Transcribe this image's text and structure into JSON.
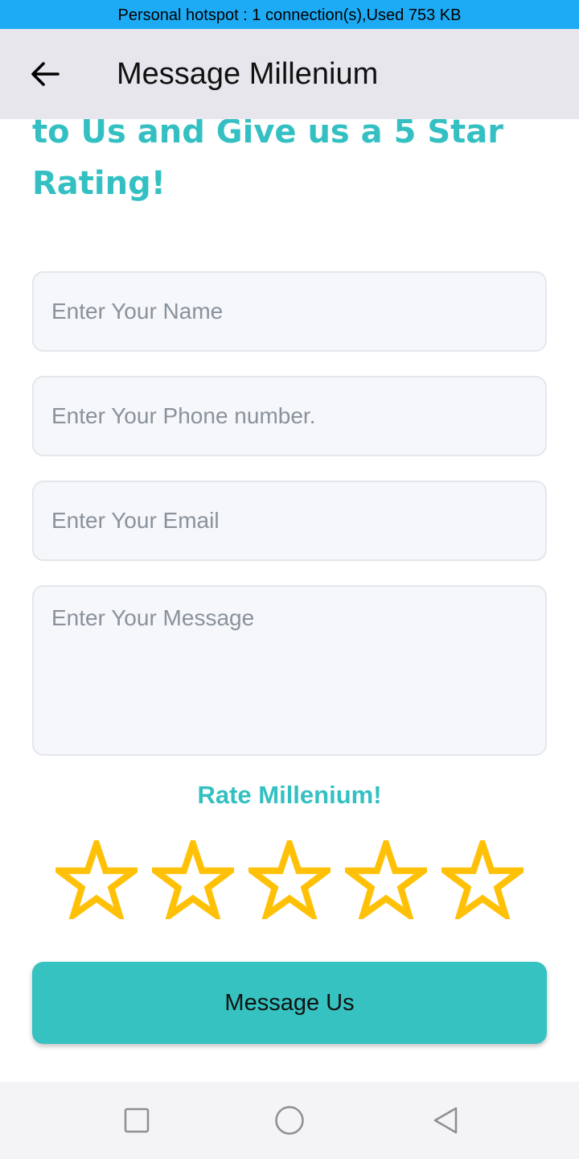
{
  "status_bar": {
    "text": "Personal hotspot : 1 connection(s),Used  753 KB",
    "background": "#1eabf5"
  },
  "app_bar": {
    "back_icon": "arrow-left-icon",
    "title": "Message Millenium",
    "background": "#e6e6ec"
  },
  "headline": {
    "line1": "to Us and Give us a 5 Star",
    "line2": "Rating!",
    "color": "#34c0c2"
  },
  "form": {
    "name": {
      "value": "",
      "placeholder": "Enter Your Name"
    },
    "phone": {
      "value": "",
      "placeholder": "Enter Your Phone number."
    },
    "email": {
      "value": "",
      "placeholder": "Enter Your Email"
    },
    "message": {
      "value": "",
      "placeholder": "Enter Your Message"
    }
  },
  "rating": {
    "label": "Rate Millenium!",
    "value": 0,
    "max": 5,
    "icon": "star-outline-icon",
    "star_color": "#ffc107"
  },
  "submit": {
    "label": "Message Us",
    "color": "#35c2c0"
  },
  "nav_bar": {
    "items": [
      "square-recents-icon",
      "circle-home-icon",
      "triangle-back-icon"
    ]
  }
}
